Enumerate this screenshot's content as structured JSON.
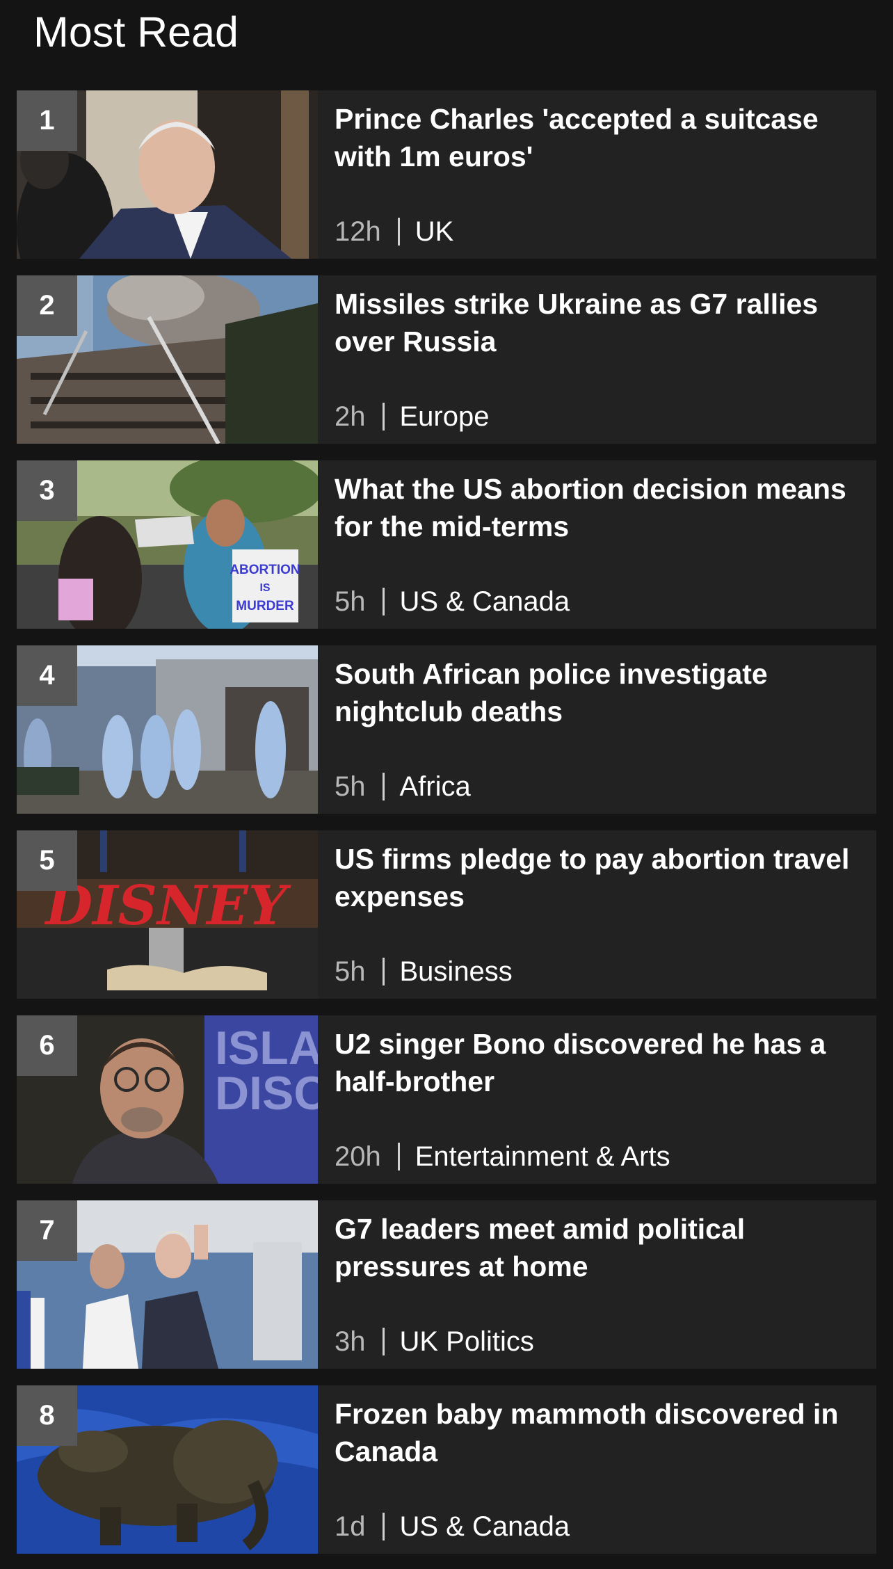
{
  "header": {
    "title": "Most Read"
  },
  "items": [
    {
      "rank": "1",
      "headline": "Prince Charles 'accepted a suitcase with 1m euros'",
      "time": "12h",
      "section": "UK"
    },
    {
      "rank": "2",
      "headline": "Missiles strike Ukraine as G7 rallies over Russia",
      "time": "2h",
      "section": "Europe"
    },
    {
      "rank": "3",
      "headline": "What the US abortion decision means for the mid-terms",
      "time": "5h",
      "section": "US & Canada"
    },
    {
      "rank": "4",
      "headline": "South African police investigate nightclub deaths",
      "time": "5h",
      "section": "Africa"
    },
    {
      "rank": "5",
      "headline": "US firms pledge to pay abortion travel expenses",
      "time": "5h",
      "section": "Business"
    },
    {
      "rank": "6",
      "headline": "U2 singer Bono discovered he has a half-brother",
      "time": "20h",
      "section": "Entertainment & Arts"
    },
    {
      "rank": "7",
      "headline": "G7 leaders meet amid political pressures at home",
      "time": "3h",
      "section": "UK Politics"
    },
    {
      "rank": "8",
      "headline": "Frozen baby mammoth discovered in Canada",
      "time": "1d",
      "section": "US & Canada"
    }
  ],
  "images": {
    "sign_text_1": "ABORTION",
    "sign_text_2": "IS",
    "sign_text_3": "MURDER",
    "logo_text": "DISNEY",
    "bg_text_1": "ISLA",
    "bg_text_2": "DISC"
  }
}
